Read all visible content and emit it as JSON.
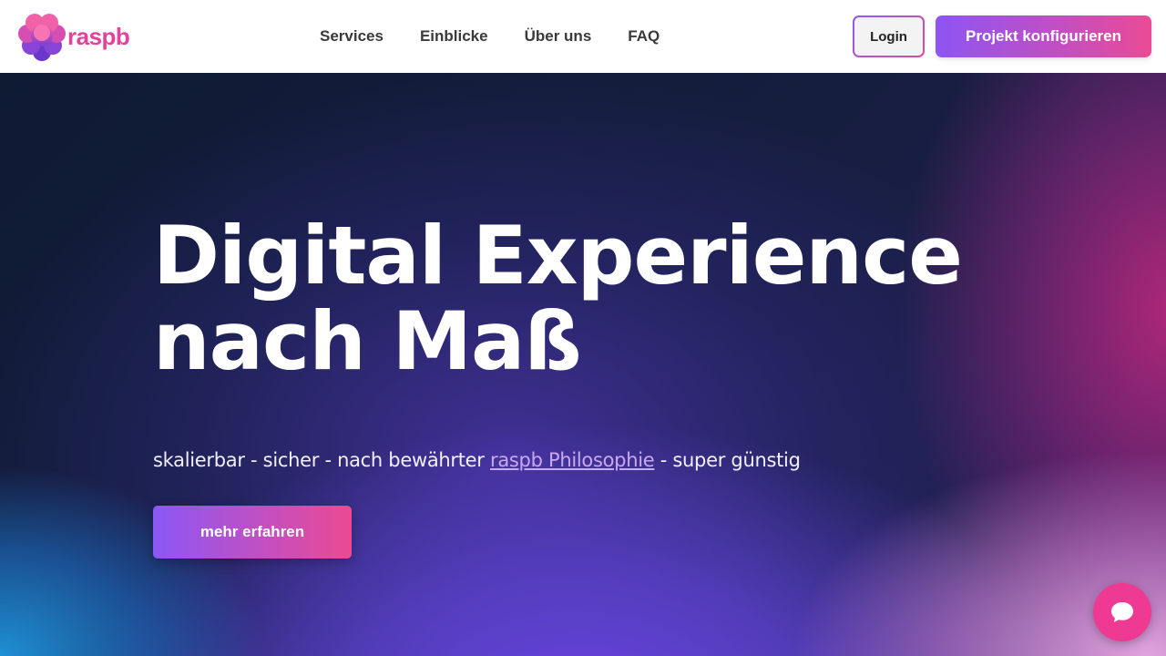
{
  "header": {
    "logo_text": "raspb",
    "nav": [
      {
        "label": "Services"
      },
      {
        "label": "Einblicke"
      },
      {
        "label": "Über uns"
      },
      {
        "label": "FAQ"
      }
    ],
    "login_label": "Login",
    "cta_label": "Projekt konfigurieren"
  },
  "hero": {
    "title_line1": "Digital Experience",
    "title_line2": "nach Maß",
    "subtitle_before": "skalierbar - sicher - nach bewährter ",
    "subtitle_link": "raspb Philosophie",
    "subtitle_after": " - super günstig",
    "button_label": "mehr erfahren"
  },
  "colors": {
    "brand_pink": "#e0449a",
    "brand_purple": "#8a58f5",
    "chat_button": "#ee3a93"
  },
  "icons": {
    "logo": "raspberry-logo-icon",
    "chat": "chat-bubble-icon"
  }
}
